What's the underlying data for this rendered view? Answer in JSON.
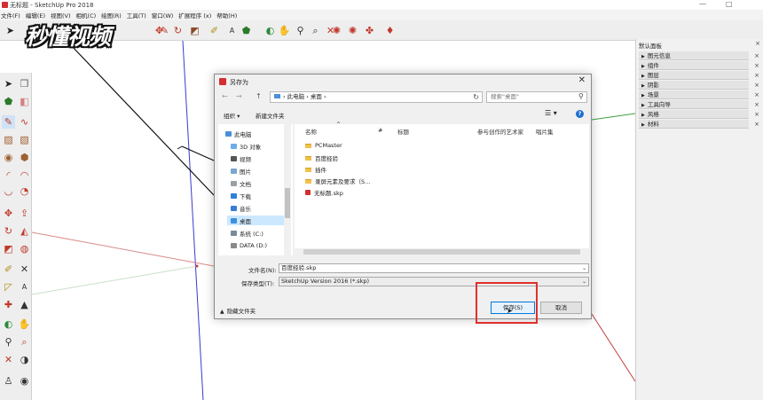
{
  "window": {
    "title": "无标题 - SketchUp Pro 2018",
    "minimize": "—",
    "maximize": "□"
  },
  "menu": [
    "文件(F)",
    "编辑(E)",
    "视图(V)",
    "相机(C)",
    "绘图(R)",
    "工具(T)",
    "窗口(W)",
    "扩展程序 (x)",
    "帮助(H)"
  ],
  "watermark": "秒懂视频",
  "tray": {
    "title": "默认面板",
    "close": "×",
    "panels": [
      "图元信息",
      "组件",
      "图层",
      "阴影",
      "场景",
      "工具向导",
      "风格",
      "材料"
    ]
  },
  "dialog": {
    "title": "另存为",
    "close": "✕",
    "nav_back": "←",
    "nav_forward": "→",
    "nav_up": "↑",
    "address": "› 此电脑 › 桌面 ›",
    "refresh": "↻",
    "search_placeholder": "搜索\"桌面\"",
    "organize": "组织 ▾",
    "new_folder": "新建文件夹",
    "help": "?",
    "nav_items": [
      {
        "label": "此电脑"
      },
      {
        "label": "3D 对象"
      },
      {
        "label": "视频"
      },
      {
        "label": "图片"
      },
      {
        "label": "文档"
      },
      {
        "label": "下载"
      },
      {
        "label": "音乐"
      },
      {
        "label": "桌面"
      },
      {
        "label": "系统 (C:)"
      },
      {
        "label": "DATA (D:)"
      }
    ],
    "columns": [
      "名称",
      "#",
      "标题",
      "参与创作的艺术家",
      "唱片集"
    ],
    "files": [
      {
        "name": "PCMaster",
        "kind": "folder"
      },
      {
        "name": "百度经验",
        "kind": "folder"
      },
      {
        "name": "插件",
        "kind": "folder"
      },
      {
        "name": "录屏元素及要求（S...",
        "kind": "folder"
      },
      {
        "name": "无标题.skp",
        "kind": "skp"
      }
    ],
    "filename_label": "文件名(N):",
    "filename_value": "百度经验.skp",
    "filetype_label": "保存类型(T):",
    "filetype_value": "SketchUp Version 2016 (*.skp)",
    "hide_folders": "隐藏文件夹",
    "save_button": "保存(S)",
    "cancel_button": "取消"
  },
  "colors": {
    "highlight_box": "#e0302c",
    "accent": "#0078d7"
  }
}
